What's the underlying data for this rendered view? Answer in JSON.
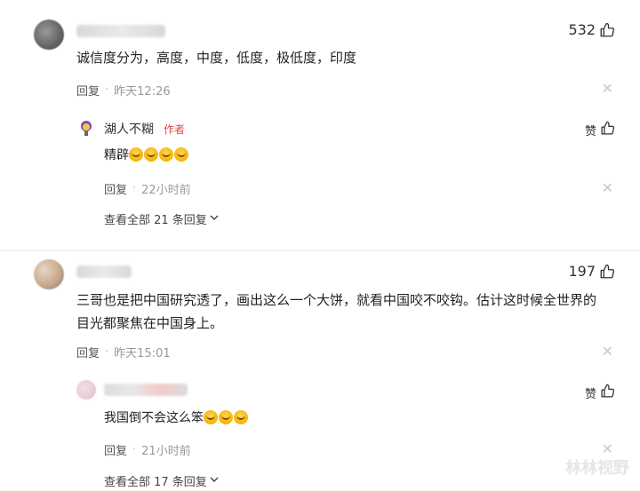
{
  "comments": [
    {
      "likes": "532",
      "text": "诚信度分为，高度，中度，低度，极低度，印度",
      "reply_label": "回复",
      "time": "昨天12:26",
      "replies": [
        {
          "author": "湖人不糊",
          "author_tag": "作者",
          "zan_label": "赞",
          "text": "精辟",
          "emoji_count": 4,
          "reply_label": "回复",
          "time": "22小时前"
        }
      ],
      "view_all": "查看全部 21 条回复"
    },
    {
      "likes": "197",
      "text_line1": "三哥也是把中国研究透了，画出这么一个大饼，就看中国咬不咬钩。估计这时候全世界的",
      "text_line2": "目光都聚焦在中国身上。",
      "reply_label": "回复",
      "time": "昨天15:01",
      "replies": [
        {
          "zan_label": "赞",
          "text": "我国倒不会这么笨",
          "emoji_count": 3,
          "reply_label": "回复",
          "time": "21小时前"
        }
      ],
      "view_all": "查看全部 17 条回复"
    }
  ],
  "separator": "·",
  "watermark": "林林视野",
  "icons": {
    "like": "thumbs-up-icon",
    "close": "close-icon",
    "chevron": "chevron-down-icon"
  },
  "colors": {
    "author_tag": "#e0443b",
    "meta_gray": "#999999"
  }
}
